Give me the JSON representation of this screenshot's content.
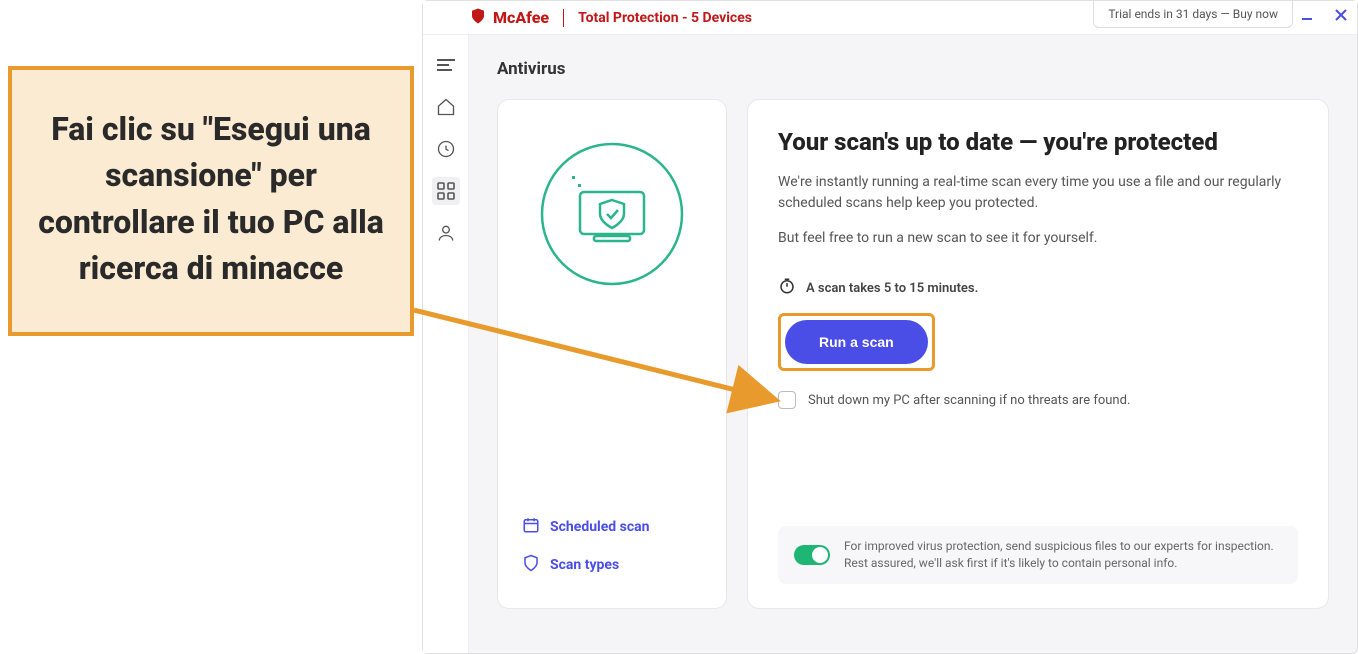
{
  "callout": {
    "text": "Fai clic su \"Esegui una scansione\" per controllare il tuo PC alla ricerca di minacce"
  },
  "header": {
    "brand": "McAfee",
    "product": "Total Protection - 5 Devices",
    "trial": "Trial ends in 31 days — Buy now"
  },
  "page": {
    "title": "Antivirus"
  },
  "left_card": {
    "scheduled": "Scheduled scan",
    "scan_types": "Scan types"
  },
  "right_card": {
    "heading": "Your scan's up to date — you're protected",
    "p1": "We're instantly running a real-time scan every time you use a file and our regularly scheduled scans help keep you protected.",
    "p2": "But feel free to run a new scan to see it for yourself.",
    "timer": "A scan takes 5 to 15 minutes.",
    "button": "Run a scan",
    "checkbox": "Shut down my PC after scanning if no threats are found.",
    "strip": "For improved virus protection, send suspicious files to our experts for inspection. Rest assured, we'll ask first if it's likely to contain personal info."
  }
}
